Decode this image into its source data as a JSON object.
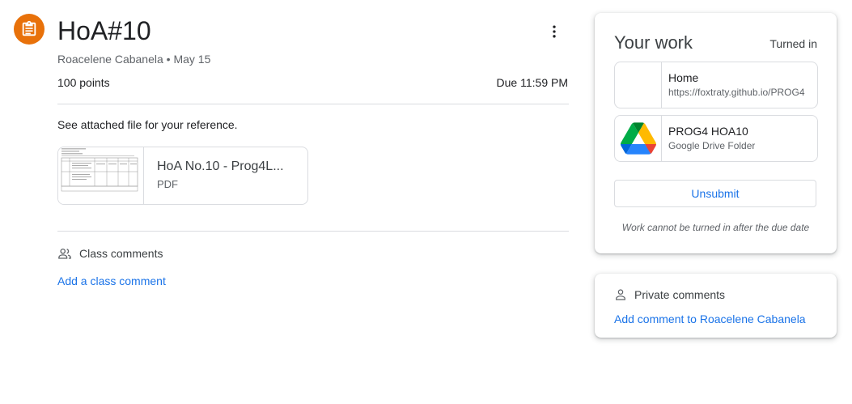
{
  "assignment": {
    "title": "HoA#10",
    "author": "Roacelene Cabanela",
    "posted": "May 15",
    "points": "100 points",
    "due": "Due 11:59 PM",
    "description": "See attached file for your reference.",
    "icon": "assignment-icon",
    "accent_color": "#e8710a"
  },
  "attachment": {
    "title": "HoA No.10 - Prog4L...",
    "type": "PDF"
  },
  "class_comments": {
    "heading": "Class comments",
    "add_label": "Add a class comment"
  },
  "your_work": {
    "title": "Your work",
    "status": "Turned in",
    "items": [
      {
        "title": "Home",
        "subtitle": "https://foxtraty.github.io/PROG4",
        "icon": "web-page-icon"
      },
      {
        "title": "PROG4 HOA10",
        "subtitle": "Google Drive Folder",
        "icon": "google-drive-icon"
      }
    ],
    "unsubmit_label": "Unsubmit",
    "note": "Work cannot be turned in after the due date"
  },
  "private_comments": {
    "heading": "Private comments",
    "add_label": "Add comment to Roacelene Cabanela"
  },
  "link_color": "#1a73e8"
}
